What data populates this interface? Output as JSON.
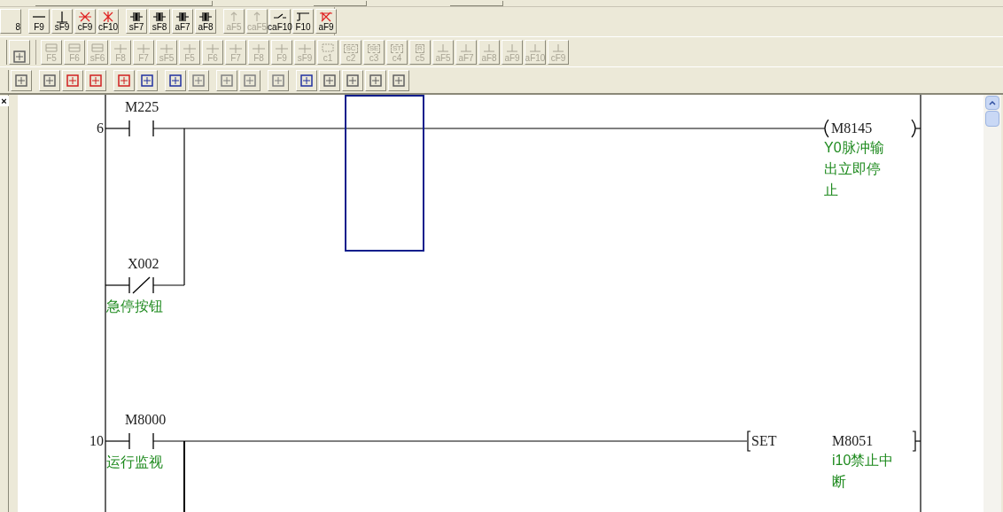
{
  "toolbar_1": {
    "buttons": [
      {
        "label": "8",
        "disabled": false
      },
      {
        "label": "F9",
        "disabled": false
      },
      {
        "label": "sF9",
        "disabled": false
      },
      {
        "label": "cF9",
        "disabled": false
      },
      {
        "label": "cF10",
        "disabled": false
      },
      {
        "label": "sF7",
        "disabled": false
      },
      {
        "label": "sF8",
        "disabled": false
      },
      {
        "label": "aF7",
        "disabled": false
      },
      {
        "label": "aF8",
        "disabled": false
      },
      {
        "label": "aF5",
        "disabled": true
      },
      {
        "label": "caF5",
        "disabled": true
      },
      {
        "label": "caF10",
        "disabled": false
      },
      {
        "label": "F10",
        "disabled": false
      },
      {
        "label": "aF9",
        "disabled": false
      }
    ]
  },
  "toolbar_2": {
    "buttons": [
      {
        "label": "F5",
        "disabled": true
      },
      {
        "label": "F6",
        "disabled": true
      },
      {
        "label": "sF6",
        "disabled": true
      },
      {
        "label": "F8",
        "disabled": true
      },
      {
        "label": "F7",
        "disabled": true
      },
      {
        "label": "sF5",
        "disabled": true
      },
      {
        "label": "F5",
        "disabled": true
      },
      {
        "label": "F6",
        "disabled": true
      },
      {
        "label": "F7",
        "disabled": true
      },
      {
        "label": "F8",
        "disabled": true
      },
      {
        "label": "F9",
        "disabled": true
      },
      {
        "label": "sF9",
        "disabled": true
      },
      {
        "label": "c1",
        "disabled": true
      },
      {
        "label": "c2",
        "icon_text": "SC",
        "disabled": true
      },
      {
        "label": "c3",
        "icon_text": "SE",
        "disabled": true
      },
      {
        "label": "c4",
        "icon_text": "ST",
        "disabled": true
      },
      {
        "label": "c5",
        "icon_text": "R",
        "disabled": true
      },
      {
        "label": "aF5",
        "disabled": true
      },
      {
        "label": "aF7",
        "disabled": true
      },
      {
        "label": "aF8",
        "disabled": true
      },
      {
        "label": "aF9",
        "disabled": true
      },
      {
        "label": "aF10",
        "disabled": true
      },
      {
        "label": "cF9",
        "disabled": true
      }
    ]
  },
  "side_panel": {
    "close": "×"
  },
  "ladder": {
    "rungs": [
      {
        "step": "6",
        "contacts": [
          {
            "kind": "no",
            "device": "M225"
          }
        ],
        "branch": {
          "kind": "nc",
          "device": "X002",
          "comment": "急停按钮"
        },
        "output": {
          "kind": "coil",
          "device": "M8145",
          "comment_lines": [
            "Y0脉冲输",
            "出立即停",
            "止"
          ]
        }
      },
      {
        "step": "10",
        "contacts": [
          {
            "kind": "no",
            "device": "M8000",
            "comment": "运行监视"
          }
        ],
        "output": {
          "kind": "instruction",
          "instruction": "SET",
          "device": "M8051",
          "comment_lines": [
            "i10禁止中",
            "断"
          ]
        },
        "continues_below": true
      }
    ]
  }
}
